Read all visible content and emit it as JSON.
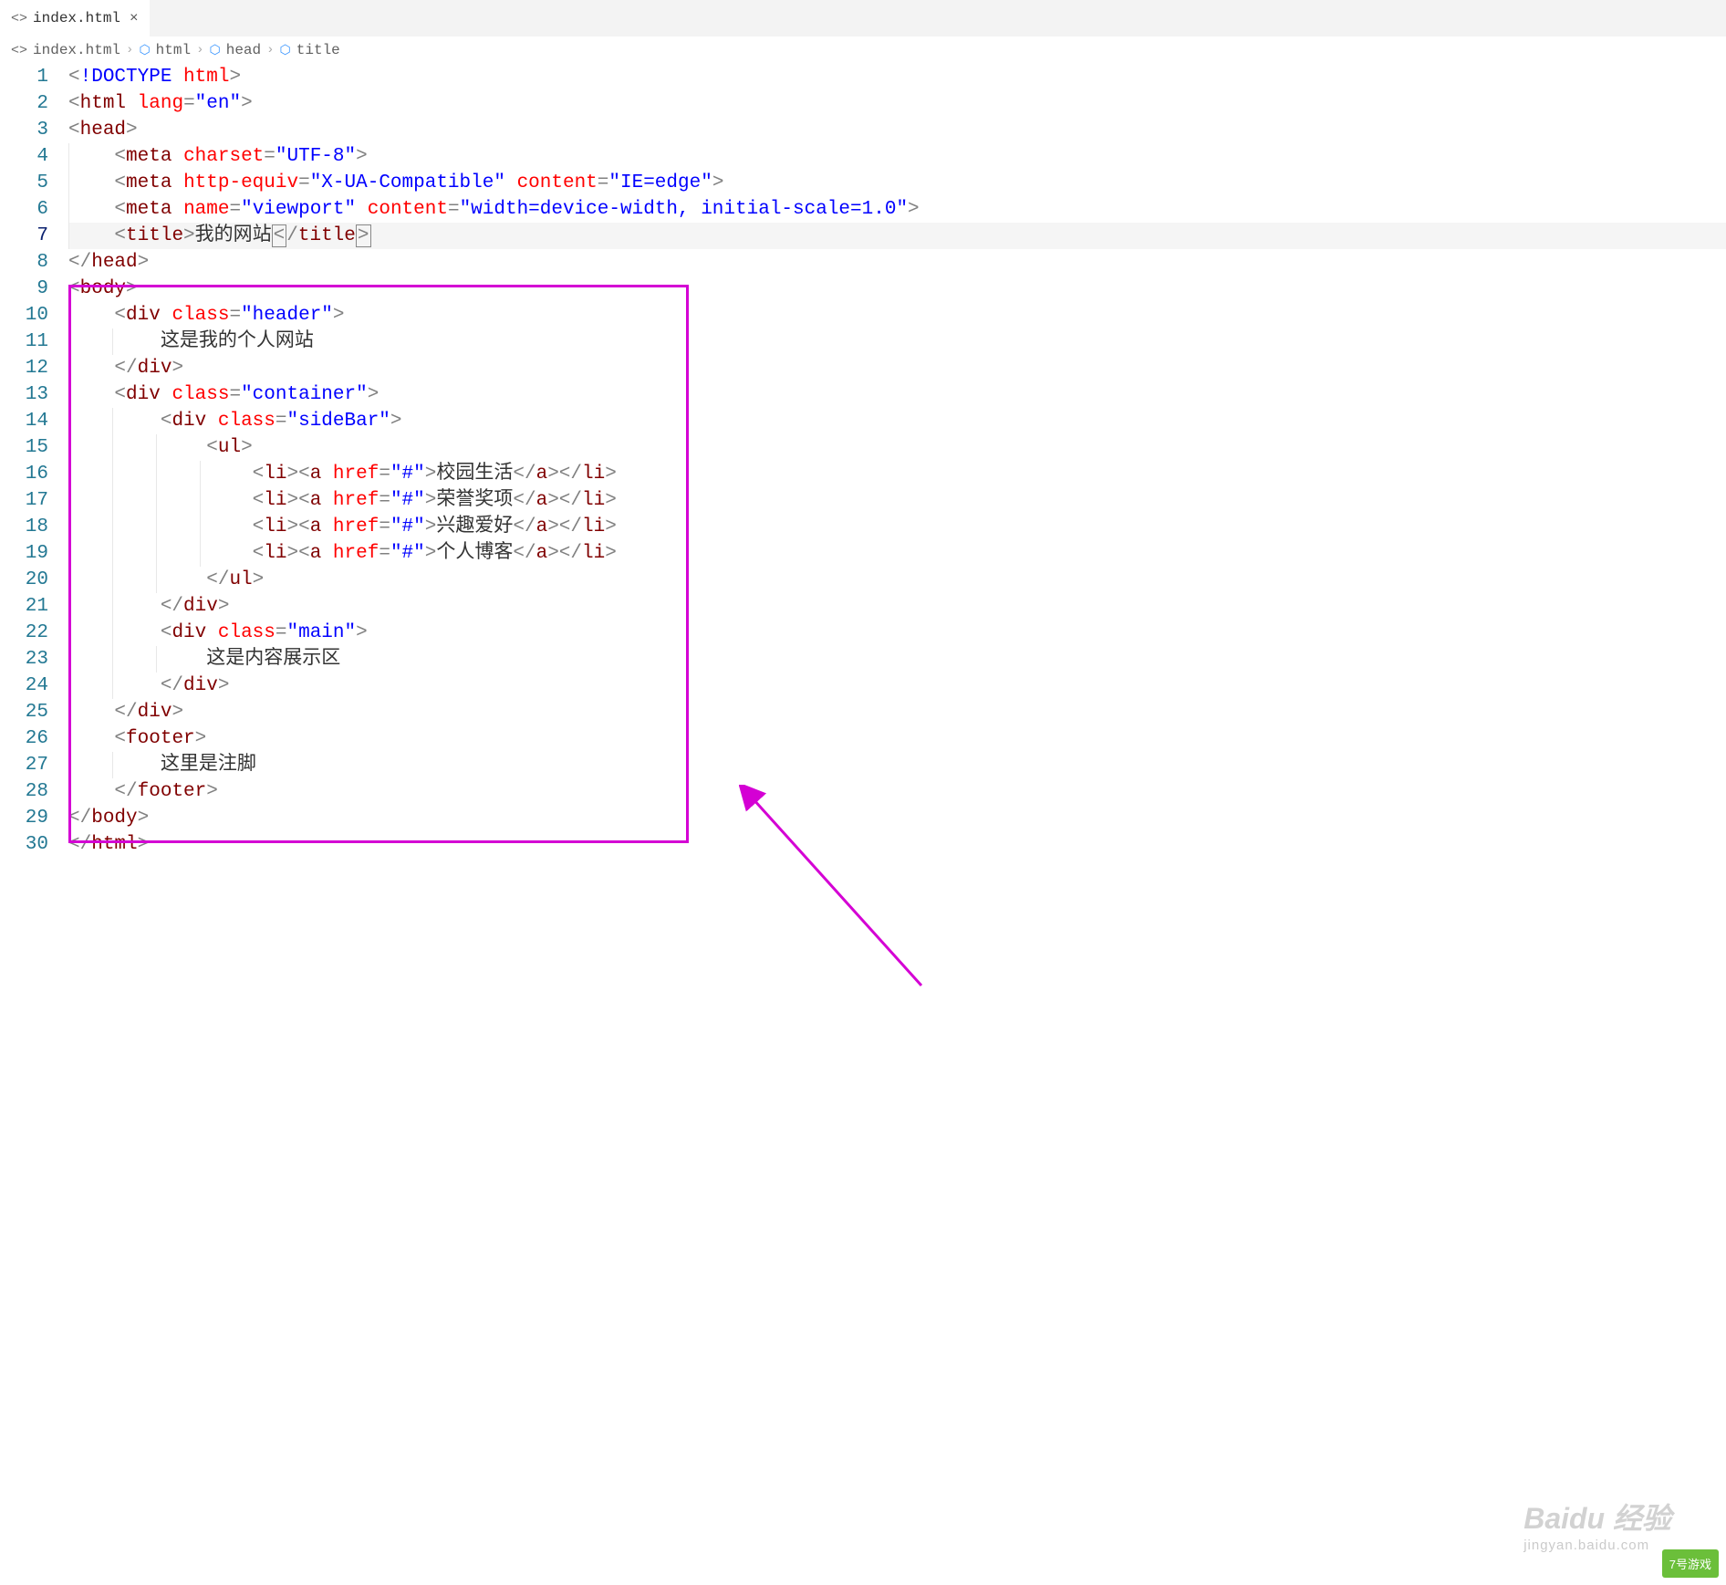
{
  "tab": {
    "icon": "<>",
    "label": "index.html",
    "close": "×"
  },
  "breadcrumb": {
    "items": [
      {
        "icon": "<>",
        "text": "index.html",
        "cube": false
      },
      {
        "icon": "",
        "text": "html",
        "cube": true
      },
      {
        "icon": "",
        "text": "head",
        "cube": true
      },
      {
        "icon": "",
        "text": "title",
        "cube": true
      }
    ]
  },
  "lineNumbers": [
    "1",
    "2",
    "3",
    "4",
    "5",
    "6",
    "7",
    "8",
    "9",
    "10",
    "11",
    "12",
    "13",
    "14",
    "15",
    "16",
    "17",
    "18",
    "19",
    "20",
    "21",
    "22",
    "23",
    "24",
    "25",
    "26",
    "27",
    "28",
    "29",
    "30"
  ],
  "code": {
    "l1_doctype": "!DOCTYPE",
    "l1_html": "html",
    "l2_tag": "html",
    "l2_attr": "lang",
    "l2_val": "\"en\"",
    "l3_tag": "head",
    "l4_tag": "meta",
    "l4_attr": "charset",
    "l4_val": "\"UTF-8\"",
    "l5_tag": "meta",
    "l5_a1": "http-equiv",
    "l5_v1": "\"X-UA-Compatible\"",
    "l5_a2": "content",
    "l5_v2": "\"IE=edge\"",
    "l6_tag": "meta",
    "l6_a1": "name",
    "l6_v1": "\"viewport\"",
    "l6_a2": "content",
    "l6_v2": "\"width=device-width, initial-scale=1.0\"",
    "l7_tag": "title",
    "l7_text": "我的网站",
    "l8_tag": "head",
    "l9_tag": "body",
    "l10_tag": "div",
    "l10_attr": "class",
    "l10_val": "\"header\"",
    "l11_text": "这是我的个人网站",
    "l12_tag": "div",
    "l13_tag": "div",
    "l13_attr": "class",
    "l13_val": "\"container\"",
    "l14_tag": "div",
    "l14_attr": "class",
    "l14_val": "\"sideBar\"",
    "l15_tag": "ul",
    "l16_li": "li",
    "l16_a": "a",
    "l16_attr": "href",
    "l16_val": "\"#\"",
    "l16_text": "校园生活",
    "l17_text": "荣誉奖项",
    "l18_text": "兴趣爱好",
    "l19_text": "个人博客",
    "l20_tag": "ul",
    "l21_tag": "div",
    "l22_tag": "div",
    "l22_attr": "class",
    "l22_val": "\"main\"",
    "l23_text": "这是内容展示区",
    "l24_tag": "div",
    "l25_tag": "div",
    "l26_tag": "footer",
    "l27_text": "这里是注脚",
    "l28_tag": "footer",
    "l29_tag": "body",
    "l30_tag": "html"
  },
  "watermark1": {
    "main": "Baidu 经验",
    "sub": "jingyan.baidu.com"
  },
  "watermark2": "7号游戏"
}
